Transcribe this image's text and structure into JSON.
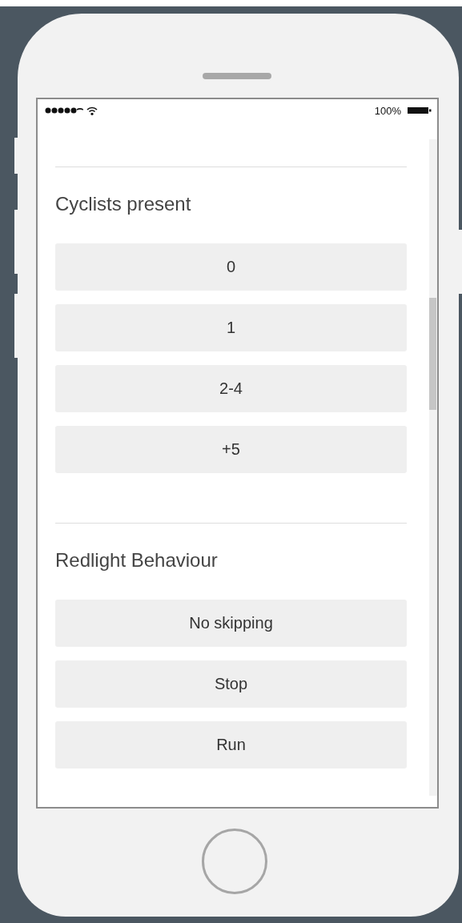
{
  "status_bar": {
    "battery": "100%"
  },
  "sections": [
    {
      "title": "Cyclists present",
      "options": [
        {
          "label": "0"
        },
        {
          "label": "1"
        },
        {
          "label": "2-4"
        },
        {
          "label": "+5"
        }
      ]
    },
    {
      "title": "Redlight Behaviour",
      "options": [
        {
          "label": "No skipping"
        },
        {
          "label": "Stop"
        },
        {
          "label": "Run"
        }
      ]
    }
  ]
}
